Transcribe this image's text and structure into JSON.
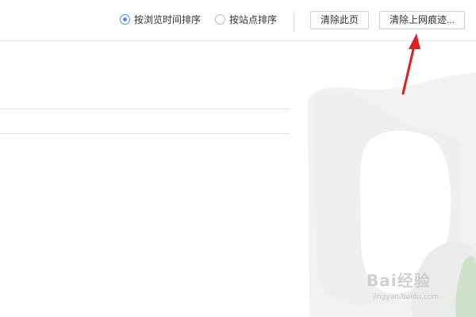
{
  "toolbar": {
    "sort_by_time_label": "按浏览时间排序",
    "sort_by_site_label": "按站点排序",
    "sort_selected": "time",
    "clear_page_label": "清除此页",
    "clear_trace_label": "清除上网痕迹..."
  },
  "watermark": {
    "logo_text": "Bai经验",
    "sub_text": "jingyan.baidu.com"
  },
  "colors": {
    "radio_accent": "#4a90e2",
    "arrow": "#e02020"
  }
}
